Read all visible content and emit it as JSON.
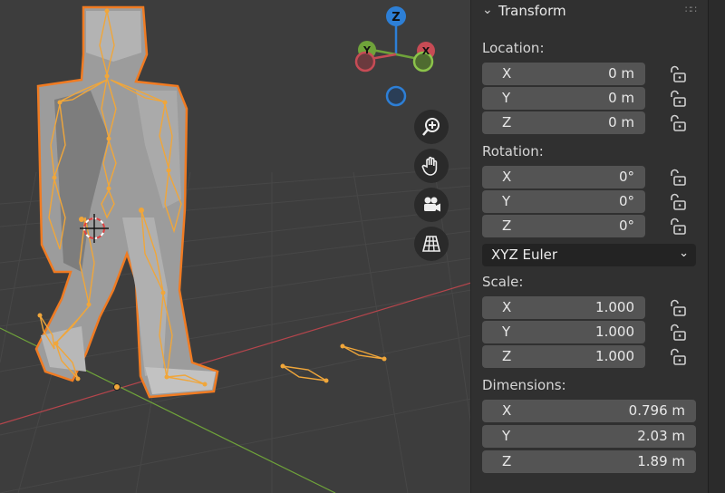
{
  "viewport": {
    "gizmo": {
      "z_label": "Z",
      "x_label": "X",
      "y_label": "Y"
    },
    "nav_buttons": [
      {
        "icon": "zoom-icon",
        "glyph": "⊕"
      },
      {
        "icon": "pan-hand-icon",
        "glyph": "✋"
      },
      {
        "icon": "camera-icon",
        "glyph": "🎥"
      },
      {
        "icon": "perspective-grid-icon",
        "glyph": "▦"
      }
    ]
  },
  "panel": {
    "title": "Transform",
    "location": {
      "label": "Location:",
      "rows": [
        {
          "axis": "X",
          "value": "0 m"
        },
        {
          "axis": "Y",
          "value": "0 m"
        },
        {
          "axis": "Z",
          "value": "0 m"
        }
      ]
    },
    "rotation": {
      "label": "Rotation:",
      "rows": [
        {
          "axis": "X",
          "value": "0°"
        },
        {
          "axis": "Y",
          "value": "0°"
        },
        {
          "axis": "Z",
          "value": "0°"
        }
      ],
      "mode": "XYZ Euler"
    },
    "scale": {
      "label": "Scale:",
      "rows": [
        {
          "axis": "X",
          "value": "1.000"
        },
        {
          "axis": "Y",
          "value": "1.000"
        },
        {
          "axis": "Z",
          "value": "1.000"
        }
      ]
    },
    "dimensions": {
      "label": "Dimensions:",
      "rows": [
        {
          "axis": "X",
          "value": "0.796 m"
        },
        {
          "axis": "Y",
          "value": "2.03 m"
        },
        {
          "axis": "Z",
          "value": "1.89 m"
        }
      ]
    }
  },
  "colors": {
    "selection_outline": "#f07b22",
    "bone": "#f0a63a",
    "x_axis": "#c74b55",
    "y_axis": "#8bc34a",
    "z_axis": "#2d7fd6"
  }
}
